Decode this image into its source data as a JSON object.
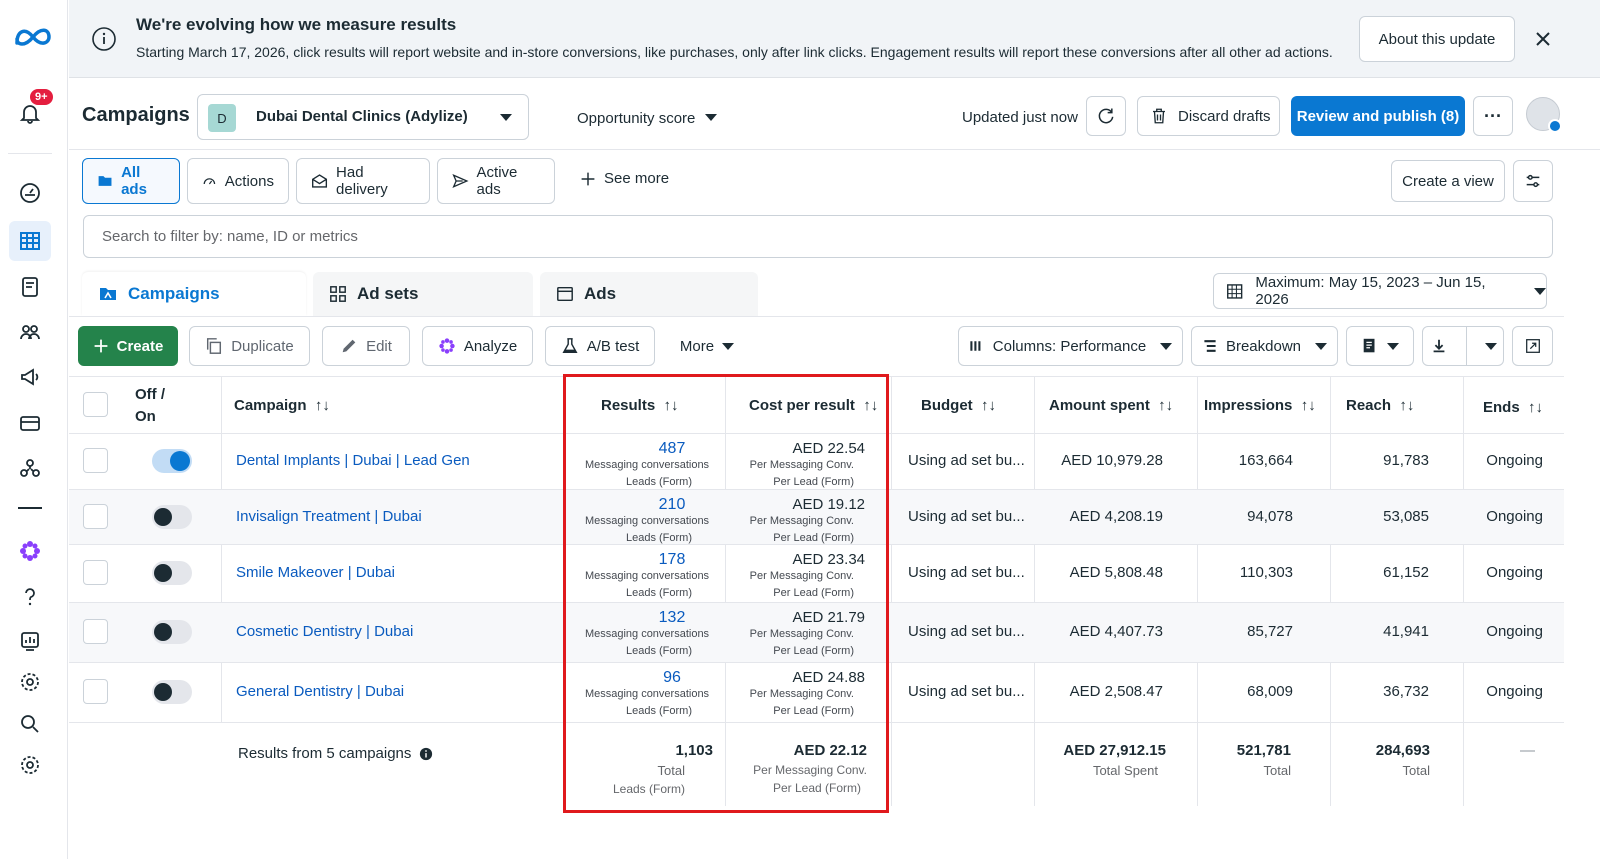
{
  "banner": {
    "title": "We're evolving how we measure results",
    "text": "Starting March 17, 2026, click results will report website and in-store conversions, like purchases, only after link clicks. Engagement results will report these conversions after all other ad actions.",
    "button": "About this update"
  },
  "rail": {
    "notification_badge": "9+"
  },
  "header": {
    "title": "Campaigns",
    "account_initial": "D",
    "account_name": "Dubai Dental Clinics (Adylize)",
    "opportunity": "Opportunity score",
    "updated": "Updated just now",
    "discard": "Discard drafts",
    "publish": "Review and publish (8)",
    "more": "···"
  },
  "filters": {
    "all_ads": "All ads",
    "actions": "Actions",
    "had_delivery": "Had delivery",
    "active_ads": "Active ads",
    "see_more": "See more",
    "create_view": "Create a view"
  },
  "search": {
    "placeholder": "Search to filter by: name, ID or metrics"
  },
  "levels": {
    "campaigns": "Campaigns",
    "adsets": "Ad sets",
    "ads": "Ads"
  },
  "date_range": "Maximum: May 15, 2023 – Jun 15, 2026",
  "toolbar": {
    "create": "Create",
    "duplicate": "Duplicate",
    "edit": "Edit",
    "analyze": "Analyze",
    "abtest": "A/B test",
    "more": "More",
    "columns": "Columns: Performance",
    "breakdown": "Breakdown"
  },
  "columns": {
    "offon_line1": "Off /",
    "offon_line2": "On",
    "campaign": "Campaign",
    "results": "Results",
    "cost_per_result": "Cost per result",
    "budget": "Budget",
    "amount_spent": "Amount spent",
    "impressions": "Impressions",
    "reach": "Reach",
    "ends": "Ends",
    "sort": "↑↓"
  },
  "rows": [
    {
      "on": true,
      "name": "Dental Implants | Dubai | Lead Gen",
      "results": "487",
      "res_sub1": "Messaging conversations",
      "res_sub2": "Leads (Form)",
      "cpr": "AED 22.54",
      "cpr_sub1": "Per Messaging Conv.",
      "cpr_sub2": "Per Lead (Form)",
      "budget": "Using ad set bu...",
      "spent": "AED 10,979.28",
      "impressions": "163,664",
      "reach": "91,783",
      "ends": "Ongoing"
    },
    {
      "on": false,
      "name": "Invisalign Treatment | Dubai",
      "results": "210",
      "res_sub1": "Messaging conversations",
      "res_sub2": "Leads (Form)",
      "cpr": "AED 19.12",
      "cpr_sub1": "Per Messaging Conv.",
      "cpr_sub2": "Per Lead (Form)",
      "budget": "Using ad set bu...",
      "spent": "AED 4,208.19",
      "impressions": "94,078",
      "reach": "53,085",
      "ends": "Ongoing"
    },
    {
      "on": false,
      "name": "Smile Makeover | Dubai",
      "results": "178",
      "res_sub1": "Messaging conversations",
      "res_sub2": "Leads (Form)",
      "cpr": "AED 23.34",
      "cpr_sub1": "Per Messaging Conv.",
      "cpr_sub2": "Per Lead (Form)",
      "budget": "Using ad set bu...",
      "spent": "AED 5,808.48",
      "impressions": "110,303",
      "reach": "61,152",
      "ends": "Ongoing"
    },
    {
      "on": false,
      "name": "Cosmetic Dentistry | Dubai",
      "results": "132",
      "res_sub1": "Messaging conversations",
      "res_sub2": "Leads (Form)",
      "cpr": "AED 21.79",
      "cpr_sub1": "Per Messaging Conv.",
      "cpr_sub2": "Per Lead (Form)",
      "budget": "Using ad set bu...",
      "spent": "AED 4,407.73",
      "impressions": "85,727",
      "reach": "41,941",
      "ends": "Ongoing"
    },
    {
      "on": false,
      "name": "General Dentistry | Dubai",
      "results": "96",
      "res_sub1": "Messaging conversations",
      "res_sub2": "Leads (Form)",
      "cpr": "AED 24.88",
      "cpr_sub1": "Per Messaging Conv.",
      "cpr_sub2": "Per Lead (Form)",
      "budget": "Using ad set bu...",
      "spent": "AED 2,508.47",
      "impressions": "68,009",
      "reach": "36,732",
      "ends": "Ongoing"
    }
  ],
  "totals": {
    "label": "Results from 5 campaigns",
    "results": "1,103",
    "results_sub1": "Total",
    "results_sub2": "Leads (Form)",
    "cpr": "AED 22.12",
    "cpr_sub1": "Per Messaging Conv.",
    "cpr_sub2": "Per Lead (Form)",
    "spent": "AED 27,912.15",
    "spent_sub": "Total Spent",
    "impressions": "521,781",
    "impressions_sub": "Total",
    "reach": "284,693",
    "reach_sub": "Total",
    "ends": "—"
  },
  "colors": {
    "accent": "#0a78d2",
    "create_green": "#24834b",
    "highlight_red": "#e0191d"
  }
}
